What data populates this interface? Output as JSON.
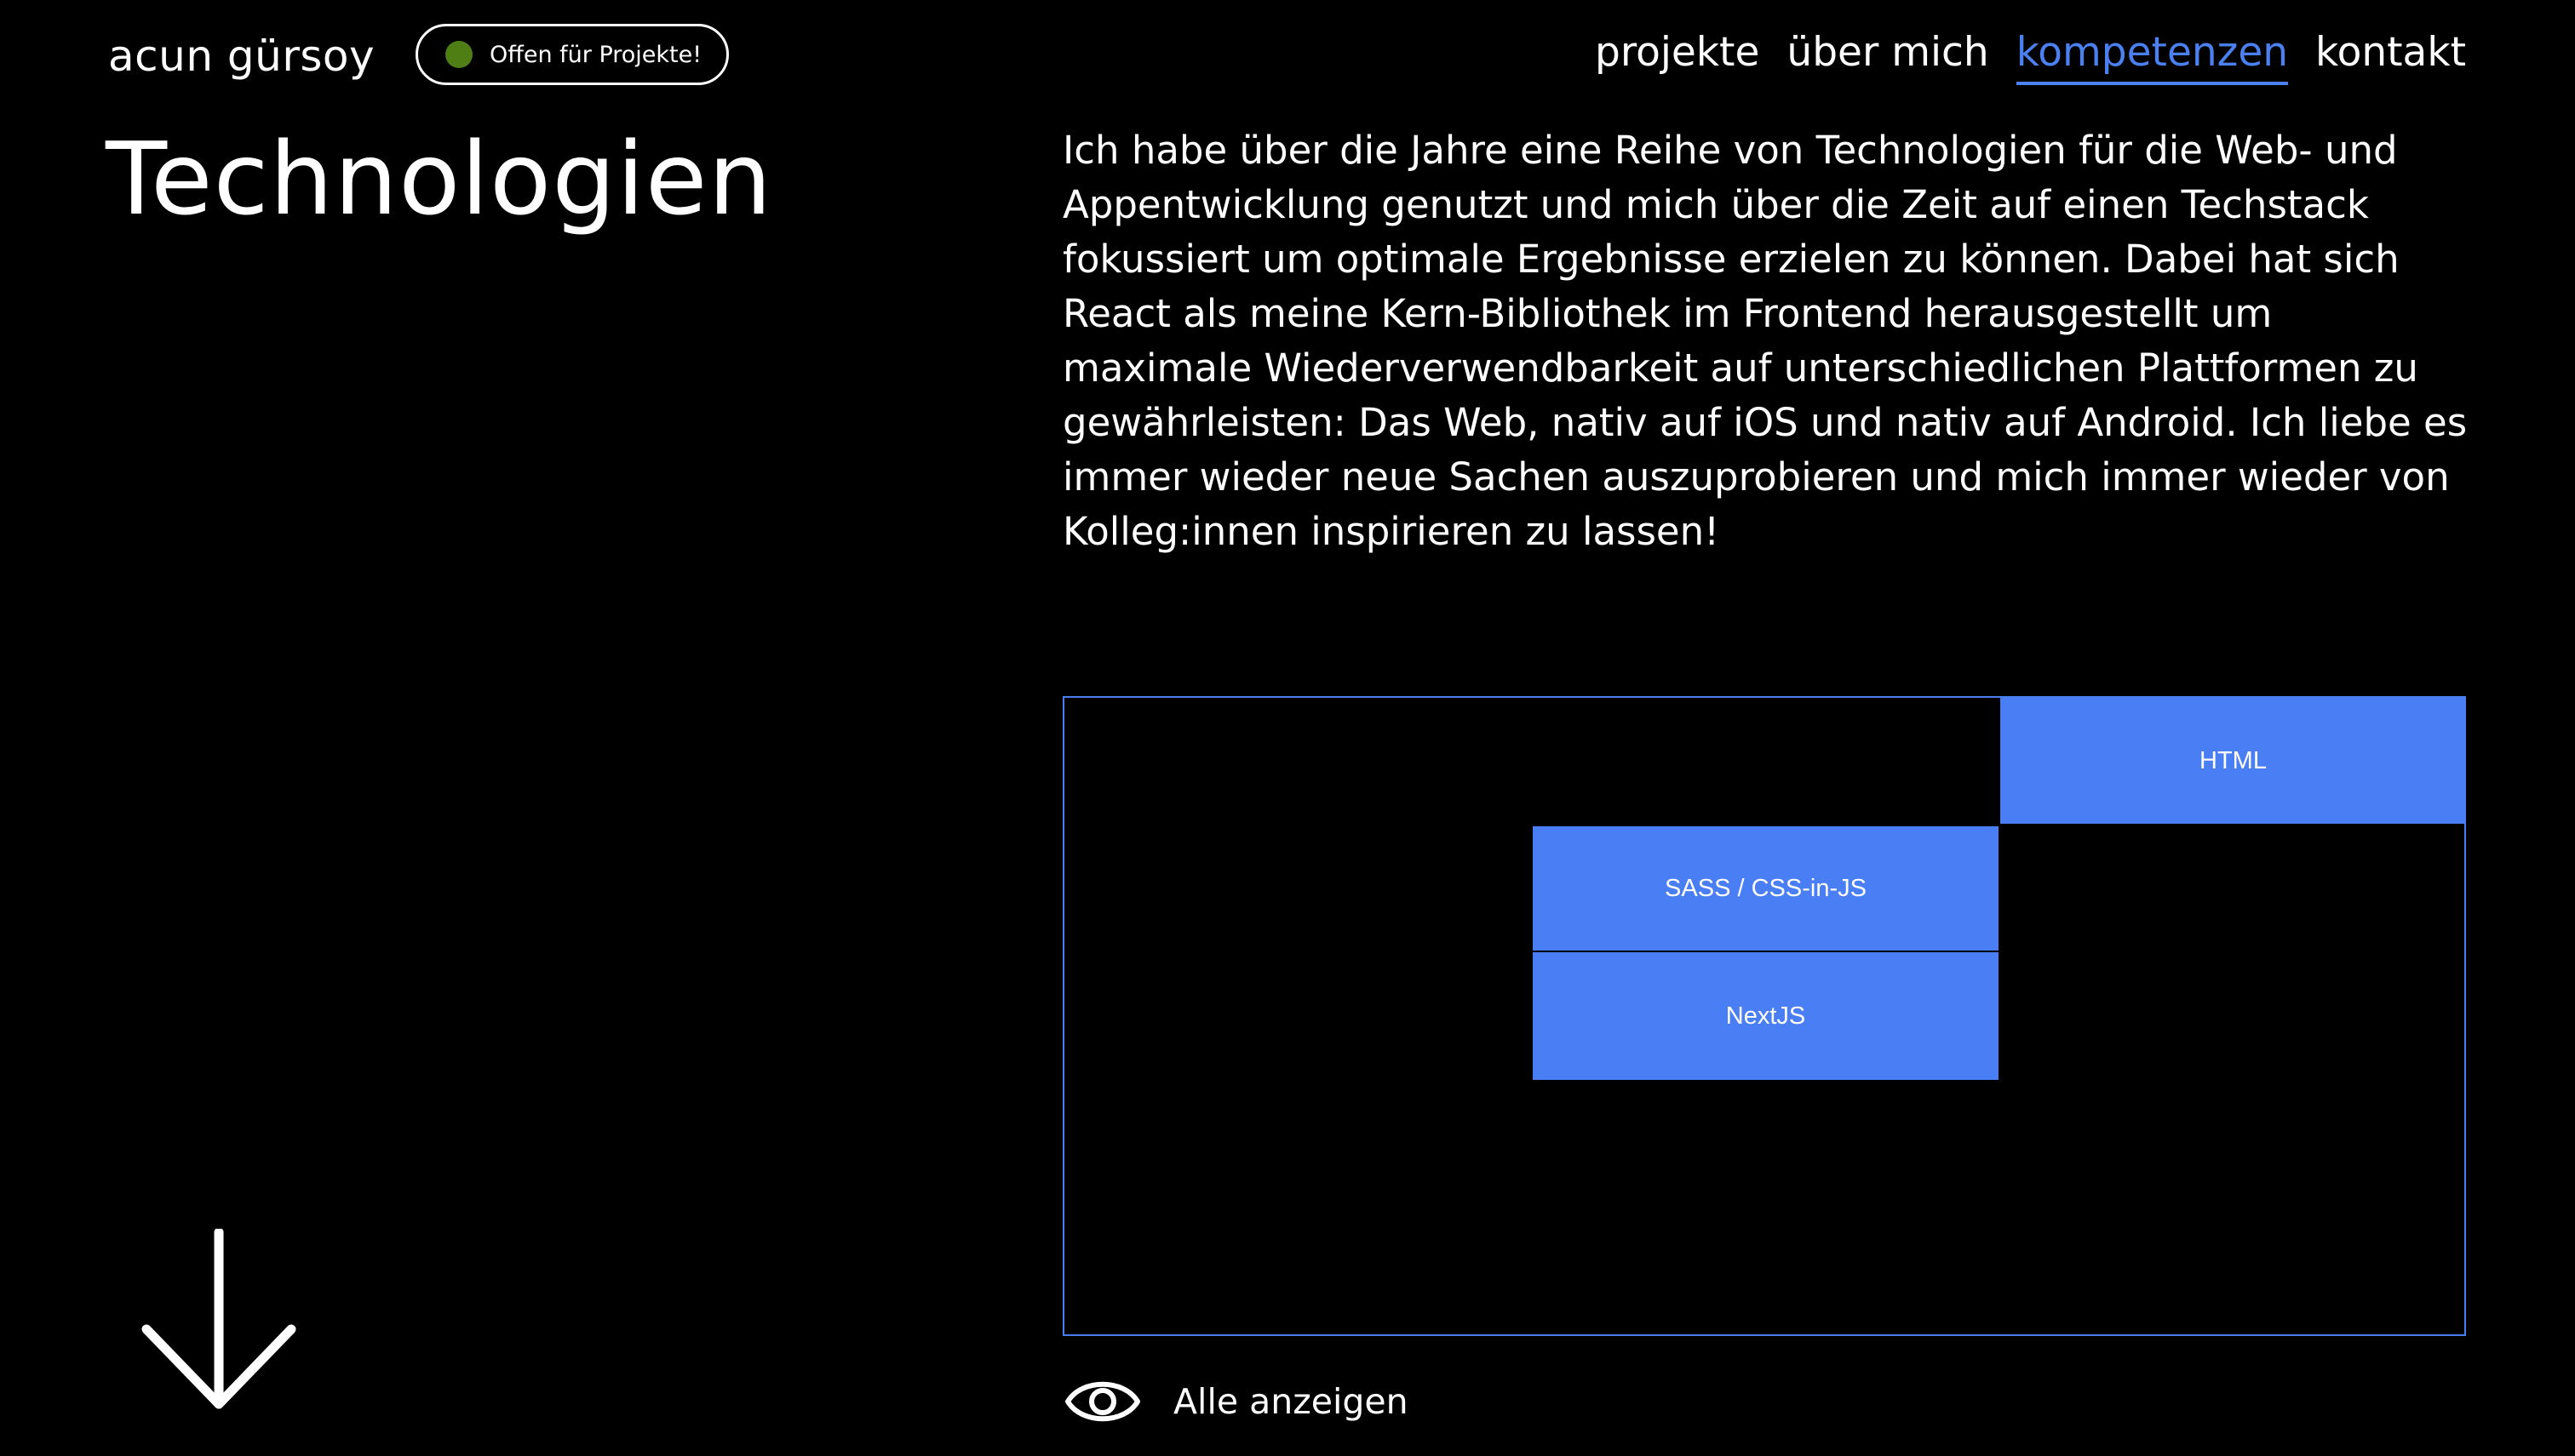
{
  "header": {
    "brand": "acun gürsoy",
    "status_badge": {
      "label": "Offen für Projekte!",
      "dot_color": "#4e7e14"
    },
    "nav": [
      {
        "label": "projekte",
        "active": false
      },
      {
        "label": "über mich",
        "active": false
      },
      {
        "label": "kompetenzen",
        "active": true
      },
      {
        "label": "kontakt",
        "active": false
      }
    ]
  },
  "colors": {
    "background": "#000000",
    "text": "#ffffff",
    "accent": "#4a80f0",
    "tile": "#4a7ef5"
  },
  "main": {
    "title": "Technologien",
    "intro": "Ich habe über die Jahre eine Reihe von Technologien für die Web- und Appentwicklung genutzt und mich über die Zeit auf einen Techstack fokussiert um optimale Ergebnisse erzielen zu können. Dabei hat sich React als meine Kern-Bibliothek im Frontend herausgestellt um maximale Wiederverwendbarkeit auf unterschiedlichen Plattformen zu gewährleisten: Das Web, nativ auf iOS und nativ auf Android. Ich liebe es immer wieder neue Sachen auszuprobieren und mich immer wieder von Kolleg:innen inspirieren zu lassen!",
    "tech_tiles": [
      {
        "label": "HTML"
      },
      {
        "label": "SASS / CSS-in-JS"
      },
      {
        "label": "NextJS"
      }
    ],
    "show_all": {
      "label": "Alle anzeigen",
      "icon": "eye-icon"
    },
    "scroll_icon": "arrow-down-icon"
  }
}
